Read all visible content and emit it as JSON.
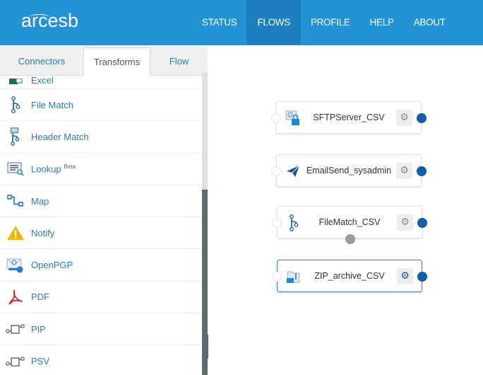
{
  "app": {
    "logo": "arcesb"
  },
  "nav": {
    "items": [
      {
        "label": "STATUS",
        "active": false
      },
      {
        "label": "FLOWS",
        "active": true
      },
      {
        "label": "PROFILE",
        "active": false
      },
      {
        "label": "HELP",
        "active": false
      },
      {
        "label": "ABOUT",
        "active": false
      }
    ]
  },
  "sidebar": {
    "tabs": [
      {
        "label": "Connectors",
        "active": false
      },
      {
        "label": "Transforms",
        "active": true
      },
      {
        "label": "Flow",
        "active": false
      }
    ],
    "items": [
      {
        "label": "Excel",
        "icon": "excel-icon"
      },
      {
        "label": "File Match",
        "icon": "file-match-icon"
      },
      {
        "label": "Header Match",
        "icon": "header-match-icon"
      },
      {
        "label": "Lookup",
        "icon": "lookup-icon",
        "badge": "Beta"
      },
      {
        "label": "Map",
        "icon": "map-icon"
      },
      {
        "label": "Notify",
        "icon": "warning-icon"
      },
      {
        "label": "OpenPGP",
        "icon": "openpgp-icon"
      },
      {
        "label": "PDF",
        "icon": "pdf-icon"
      },
      {
        "label": "PIP",
        "icon": "pip-icon"
      },
      {
        "label": "PSV",
        "icon": "psv-icon"
      }
    ],
    "collapse_glyph": "‹"
  },
  "canvas": {
    "nodes": [
      {
        "label": "SFTPServer_CSV",
        "icon": "sftp-icon",
        "selected": false
      },
      {
        "label": "EmailSend_sysadmin",
        "icon": "paper-plane-icon",
        "selected": false
      },
      {
        "label": "FileMatch_CSV",
        "icon": "file-match-icon",
        "selected": false
      },
      {
        "label": "ZIP_archive_CSV",
        "icon": "zip-icon",
        "selected": true
      }
    ],
    "gear_glyph": "⚙"
  },
  "colors": {
    "header": "#2393d6",
    "nav_active": "#1e7fbe",
    "link": "#2a7bb8",
    "port": "#0e5ea8"
  }
}
